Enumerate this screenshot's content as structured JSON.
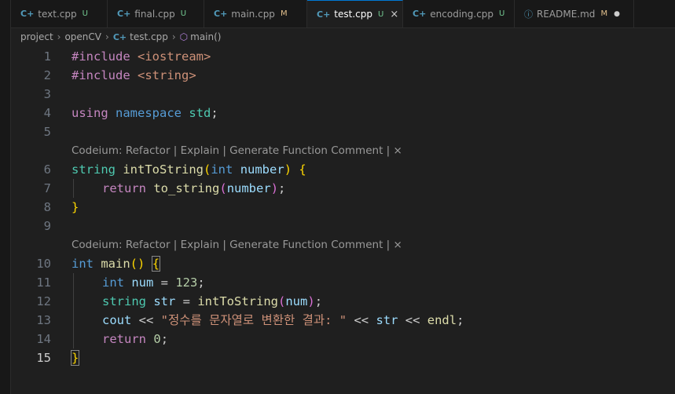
{
  "tabs": [
    {
      "icon": "C+",
      "label": "text.cpp",
      "status": "U"
    },
    {
      "icon": "C+",
      "label": "final.cpp",
      "status": "U"
    },
    {
      "icon": "C+",
      "label": "main.cpp",
      "status": "M"
    },
    {
      "icon": "C+",
      "label": "test.cpp",
      "status": "U",
      "close": "×"
    },
    {
      "icon": "C+",
      "label": "encoding.cpp",
      "status": "U"
    },
    {
      "icon": "ⓘ",
      "label": "README.md",
      "status": "M",
      "dirty": "●"
    }
  ],
  "breadcrumb": {
    "folder1": "project",
    "folder2": "openCV",
    "file_icon": "C+",
    "file": "test.cpp",
    "symbol": "main()"
  },
  "codelens": {
    "lens1": "Codeium: Refactor | Explain | Generate Function Comment | ×",
    "lens2": "Codeium: Refactor | Explain | Generate Function Comment | ×"
  },
  "code": {
    "l1": {
      "num": "1",
      "a": "#include ",
      "b": "<iostream>"
    },
    "l2": {
      "num": "2",
      "a": "#include ",
      "b": "<string>"
    },
    "l3": {
      "num": "3"
    },
    "l4": {
      "num": "4",
      "a": "using",
      "b": " ",
      "c": "namespace",
      "d": " ",
      "e": "std",
      "f": ";"
    },
    "l5": {
      "num": "5"
    },
    "l6": {
      "num": "6",
      "a": "string",
      "b": " ",
      "c": "intToString",
      "d": "(",
      "e": "int",
      "f": " ",
      "g": "number",
      "h": ")",
      "i": " {"
    },
    "l7": {
      "num": "7",
      "a": "return",
      "b": " ",
      "c": "to_string",
      "d": "(",
      "e": "number",
      "f": ")",
      "g": ";"
    },
    "l8": {
      "num": "8",
      "a": "}"
    },
    "l9": {
      "num": "9"
    },
    "l10": {
      "num": "10",
      "a": "int",
      "b": " ",
      "c": "main",
      "d": "()",
      "e": " ",
      "f": "{"
    },
    "l11": {
      "num": "11",
      "a": "int",
      "b": " ",
      "c": "num",
      "d": " = ",
      "e": "123",
      "f": ";"
    },
    "l12": {
      "num": "12",
      "a": "string",
      "b": " ",
      "c": "str",
      "d": " = ",
      "e": "intToString",
      "f": "(",
      "g": "num",
      "h": ")",
      "i": ";"
    },
    "l13": {
      "num": "13",
      "a": "cout",
      "b": " << ",
      "c": "\"정수를 문자열로 변환한 결과: \"",
      "d": " << ",
      "e": "str",
      "f": " << ",
      "g": "endl",
      "h": ";"
    },
    "l14": {
      "num": "14",
      "a": "return",
      "b": " ",
      "c": "0",
      "d": ";"
    },
    "l15": {
      "num": "15",
      "a": "}"
    }
  }
}
